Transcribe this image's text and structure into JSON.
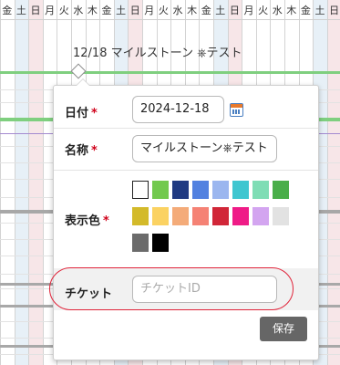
{
  "calendar": {
    "day_labels": [
      "金",
      "土",
      "日",
      "月",
      "火",
      "水",
      "木",
      "金",
      "土",
      "日",
      "月",
      "火",
      "水",
      "木",
      "金",
      "土",
      "日",
      "月",
      "火",
      "水",
      "木",
      "金",
      "土",
      "日"
    ],
    "weekend_colors": {
      "sat": "#e7f0f7",
      "sun": "#f7e6e8"
    },
    "milestone_label": "12/18 マイルストーン ⎈テスト",
    "milestone_line_color": "#7fcf7f"
  },
  "popover": {
    "date": {
      "label": "日付",
      "required_mark": "*",
      "value": "2024-12-18",
      "icon": "calendar-icon"
    },
    "name": {
      "label": "名称",
      "required_mark": "*",
      "value": "マイルストーン⎈テスト"
    },
    "color": {
      "label": "表示色",
      "required_mark": "*",
      "swatches": [
        {
          "color": "#ffffff",
          "selected": true
        },
        {
          "color": "#72c94e",
          "selected": false
        },
        {
          "color": "#203a82",
          "selected": false
        },
        {
          "color": "#5281e0",
          "selected": false
        },
        {
          "color": "#9bb6ef",
          "selected": false
        },
        {
          "color": "#3fc6d0",
          "selected": false
        },
        {
          "color": "#7fddb5",
          "selected": false
        },
        {
          "color": "#4aae4a",
          "selected": false
        },
        {
          "color": "#d3ba2a",
          "selected": false
        },
        {
          "color": "#fbd262",
          "selected": false
        },
        {
          "color": "#f4ab79",
          "selected": false
        },
        {
          "color": "#f58275",
          "selected": false
        },
        {
          "color": "#d12638",
          "selected": false
        },
        {
          "color": "#ef1b87",
          "selected": false
        },
        {
          "color": "#d3a5f0",
          "selected": false
        },
        {
          "color": "#e2e2e2",
          "selected": false
        },
        {
          "color": "#6b6b6b",
          "selected": false
        },
        {
          "color": "#000000",
          "selected": false
        }
      ]
    },
    "ticket": {
      "label": "チケット",
      "placeholder": "チケットID",
      "value": ""
    },
    "save_label": "保存",
    "highlight_color": "#e0243a"
  }
}
